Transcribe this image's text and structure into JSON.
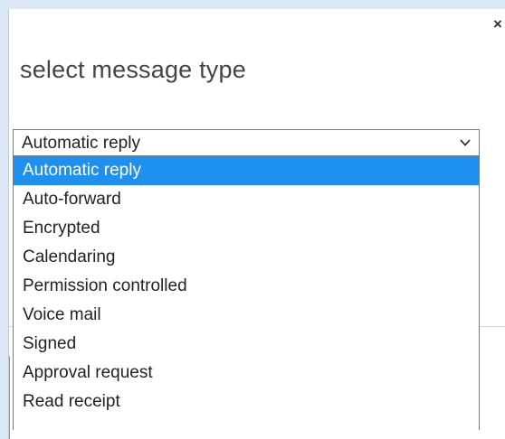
{
  "dialog": {
    "title": "select message type",
    "close_label": "×"
  },
  "select": {
    "current_value": "Automatic reply",
    "options": [
      "Automatic reply",
      "Auto-forward",
      "Encrypted",
      "Calendaring",
      "Permission controlled",
      "Voice mail",
      "Signed",
      "Approval request",
      "Read receipt"
    ],
    "selected_index": 0
  },
  "colors": {
    "background": "#dbe9f6",
    "highlight": "#1e90f0"
  },
  "icons": {
    "close": "close-icon",
    "chevron": "chevron-down-icon"
  }
}
